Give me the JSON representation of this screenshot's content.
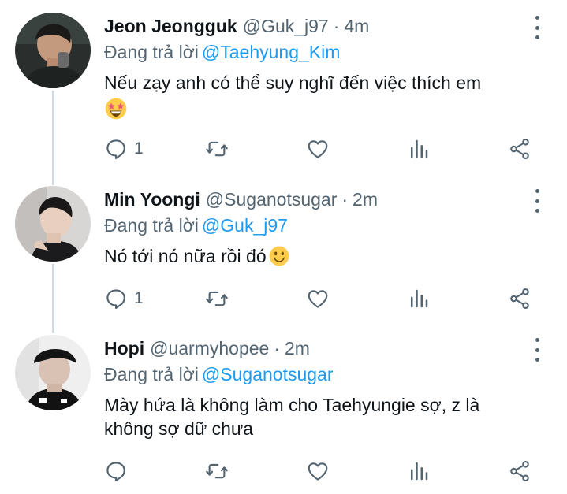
{
  "colors": {
    "accent": "#1d9bf0",
    "muted": "#536471",
    "text": "#0f1419",
    "thread_line": "#cfd9de"
  },
  "tweets": [
    {
      "name": "Jeon Jeongguk",
      "handle": "@Guk_j97",
      "separator": "·",
      "time": "4m",
      "reply_prefix": "Đang trả lời",
      "reply_to": "@Taehyung_Kim",
      "text": "Nếu zạy anh có thể suy nghĩ đến việc thích em",
      "emoji": "star-struck-emoji",
      "reply_count": "1"
    },
    {
      "name": "Min Yoongi",
      "handle": "@Suganotsugar",
      "separator": "·",
      "time": "2m",
      "reply_prefix": "Đang trả lời",
      "reply_to": "@Guk_j97",
      "text": "Nó tới nó nữa rồi đó",
      "emoji": "slightly-smiling-emoji",
      "reply_count": "1"
    },
    {
      "name": "Hopi",
      "handle": "@uarmyhopee",
      "separator": "·",
      "time": "2m",
      "reply_prefix": "Đang trả lời",
      "reply_to": "@Suganotsugar",
      "text": "Mày hứa là không làm cho Taehyungie sợ, z là không sợ dữ chưa",
      "emoji": "",
      "reply_count": ""
    }
  ],
  "icons": {
    "reply": "reply-icon",
    "retweet": "retweet-icon",
    "like": "heart-icon",
    "analytics": "analytics-icon",
    "share": "share-icon",
    "more": "more-vertical-icon"
  }
}
